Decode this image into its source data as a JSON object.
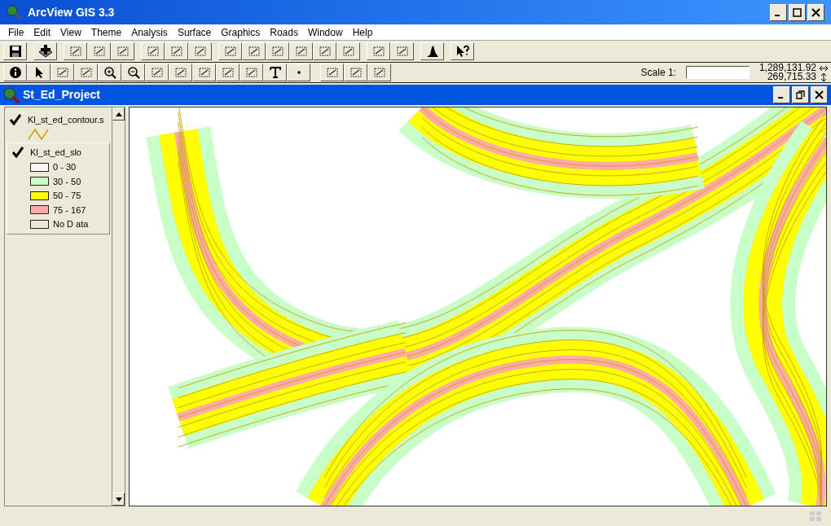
{
  "window": {
    "title": "ArcView GIS 3.3"
  },
  "menu": [
    "File",
    "Edit",
    "View",
    "Theme",
    "Analysis",
    "Surface",
    "Graphics",
    "Roads",
    "Window",
    "Help"
  ],
  "toolbar2": {
    "scale_label": "Scale 1:",
    "x_coord": "1,289,131.92",
    "y_coord": "269,715.33"
  },
  "view": {
    "title": "St_Ed_Project",
    "themes": [
      {
        "kind": "line",
        "name": "Kl_st_ed_contour.s",
        "checked": true,
        "active": false,
        "color": "#c8a000"
      },
      {
        "kind": "classes",
        "name": "Kl_st_ed_slo",
        "checked": true,
        "active": true,
        "classes": [
          {
            "label": "0 - 30",
            "color": "#f8f8f4"
          },
          {
            "label": "30 - 50",
            "color": "#c8ffc8"
          },
          {
            "label": "50 - 75",
            "color": "#ffff00"
          },
          {
            "label": "75 - 167",
            "color": "#ffaaaa"
          },
          {
            "label": "No D ata",
            "color": "#ece9d8"
          }
        ]
      }
    ]
  }
}
